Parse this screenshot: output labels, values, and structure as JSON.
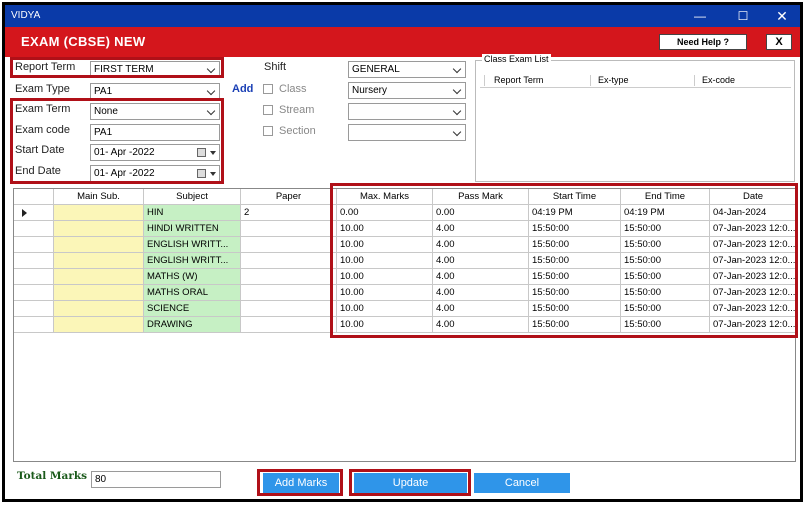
{
  "window": {
    "app_title": "VIDYA",
    "min_glyph": "—",
    "max_glyph": "☐",
    "close_glyph": "✕"
  },
  "header": {
    "title": "EXAM (CBSE) NEW",
    "help_label": "Need Help ?",
    "close_label": "X"
  },
  "form": {
    "report_term_label": "Report Term",
    "report_term_value": "FIRST TERM",
    "exam_type_label": "Exam Type",
    "exam_type_value": "PA1",
    "add_label": "Add",
    "exam_term_label": "Exam Term",
    "exam_term_value": "None",
    "exam_code_label": "Exam code",
    "exam_code_value": "PA1",
    "start_date_label": "Start Date",
    "start_date_value": "01- Apr -2022",
    "end_date_label": "End Date",
    "end_date_value": "01- Apr -2022",
    "shift_label": "Shift",
    "shift_value": "GENERAL",
    "class_label": "Class",
    "class_value": "Nursery",
    "stream_label": "Stream",
    "stream_value": "",
    "section_label": "Section",
    "section_value": ""
  },
  "class_exam_list": {
    "title": "Class Exam List",
    "columns": [
      "Report Term",
      "Ex-type",
      "Ex-code"
    ]
  },
  "grid": {
    "columns": [
      "Main Sub.",
      "Subject",
      "Paper",
      "Max. Marks",
      "Pass Mark",
      "Start Time",
      "End Time",
      "Date"
    ],
    "rows": [
      {
        "main": "",
        "subject": "HIN",
        "paper": "2",
        "max": "0.00",
        "pass": "0.00",
        "start": "04:19 PM",
        "end": "04:19 PM",
        "date": "04-Jan-2024"
      },
      {
        "main": "",
        "subject": "HINDI WRITTEN",
        "paper": "",
        "max": "10.00",
        "pass": "4.00",
        "start": "15:50:00",
        "end": "15:50:00",
        "date": "07-Jan-2023 12:0..."
      },
      {
        "main": "",
        "subject": "ENGLISH WRITT...",
        "paper": "",
        "max": "10.00",
        "pass": "4.00",
        "start": "15:50:00",
        "end": "15:50:00",
        "date": "07-Jan-2023 12:0..."
      },
      {
        "main": "",
        "subject": "ENGLISH WRITT...",
        "paper": "",
        "max": "10.00",
        "pass": "4.00",
        "start": "15:50:00",
        "end": "15:50:00",
        "date": "07-Jan-2023 12:0..."
      },
      {
        "main": "",
        "subject": "MATHS (W)",
        "paper": "",
        "max": "10.00",
        "pass": "4.00",
        "start": "15:50:00",
        "end": "15:50:00",
        "date": "07-Jan-2023 12:0..."
      },
      {
        "main": "",
        "subject": "MATHS ORAL",
        "paper": "",
        "max": "10.00",
        "pass": "4.00",
        "start": "15:50:00",
        "end": "15:50:00",
        "date": "07-Jan-2023 12:0..."
      },
      {
        "main": "",
        "subject": "SCIENCE",
        "paper": "",
        "max": "10.00",
        "pass": "4.00",
        "start": "15:50:00",
        "end": "15:50:00",
        "date": "07-Jan-2023 12:0..."
      },
      {
        "main": "",
        "subject": "DRAWING",
        "paper": "",
        "max": "10.00",
        "pass": "4.00",
        "start": "15:50:00",
        "end": "15:50:00",
        "date": "07-Jan-2023 12:0..."
      }
    ]
  },
  "footer": {
    "total_marks_label": "Total Marks",
    "total_marks_value": "80",
    "add_marks_label": "Add Marks",
    "update_label": "Update",
    "cancel_label": "Cancel"
  },
  "colors": {
    "titlebar": "#0a3aa8",
    "header_bar": "#d4161c",
    "highlight_border": "#b01018",
    "button": "#2f95e9",
    "main_sub_fill": "#fbf6b8",
    "subject_fill": "#c6f0c4"
  }
}
